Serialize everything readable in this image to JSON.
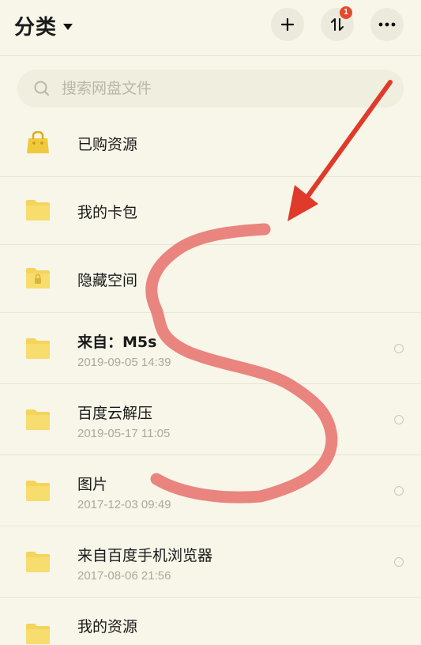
{
  "header": {
    "title": "分类",
    "badge_count": "1",
    "icons": [
      "plus-icon",
      "transfer-icon",
      "more-icon",
      "chevron-down-icon"
    ]
  },
  "search": {
    "placeholder": "搜索网盘文件"
  },
  "colors": {
    "background": "#f7f6e9",
    "folder": "#f4d45c",
    "badge": "#e8492c",
    "annotation": "#e87a74",
    "arrow": "#e03a2a"
  },
  "items": [
    {
      "name": "已购资源",
      "date": "",
      "icon": "shopping-bag-icon"
    },
    {
      "name": "我的卡包",
      "date": "",
      "icon": "folder-icon"
    },
    {
      "name": "隐藏空间",
      "date": "",
      "icon": "locked-folder-icon"
    },
    {
      "name": "来自：M5s",
      "date": "2019-09-05  14:39",
      "icon": "folder-icon"
    },
    {
      "name": "百度云解压",
      "date": "2019-05-17  11:05",
      "icon": "folder-icon"
    },
    {
      "name": "图片",
      "date": "2017-12-03  09:49",
      "icon": "folder-icon"
    },
    {
      "name": "来自百度手机浏览器",
      "date": "2017-08-06  21:56",
      "icon": "folder-icon"
    },
    {
      "name": "我的资源",
      "date": "",
      "icon": "folder-icon"
    }
  ]
}
